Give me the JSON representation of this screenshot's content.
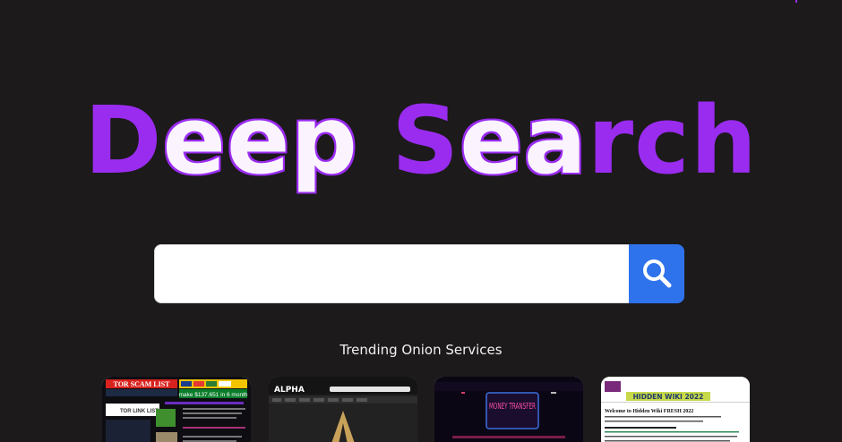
{
  "logo": {
    "word1_initial": "D",
    "word1_rest": "eep",
    "word2_initial": "S",
    "word2_rest": "ea",
    "word2_end": "rch"
  },
  "search": {
    "placeholder": "",
    "value": "",
    "button_icon": "search-icon"
  },
  "trending": {
    "heading": "Trending Onion Services",
    "cards": [
      {
        "name": "tor-scam-list",
        "banner": "TOR SCAM LIST",
        "promo": "make $137.651 in 6 month",
        "sub": "TOR LINK LIST"
      },
      {
        "name": "alpha-market",
        "banner": "ALPHA"
      },
      {
        "name": "money-transfer",
        "banner": "MONEY TRANSFER"
      },
      {
        "name": "hidden-wiki",
        "banner": "HIDDEN WIKI 2022",
        "title": "Welcome to Hidden Wiki FRESH 2022"
      }
    ]
  },
  "colors": {
    "background": "#1c1a1b",
    "accent_purple": "#9a2cf0",
    "search_blue": "#2f73ec"
  }
}
